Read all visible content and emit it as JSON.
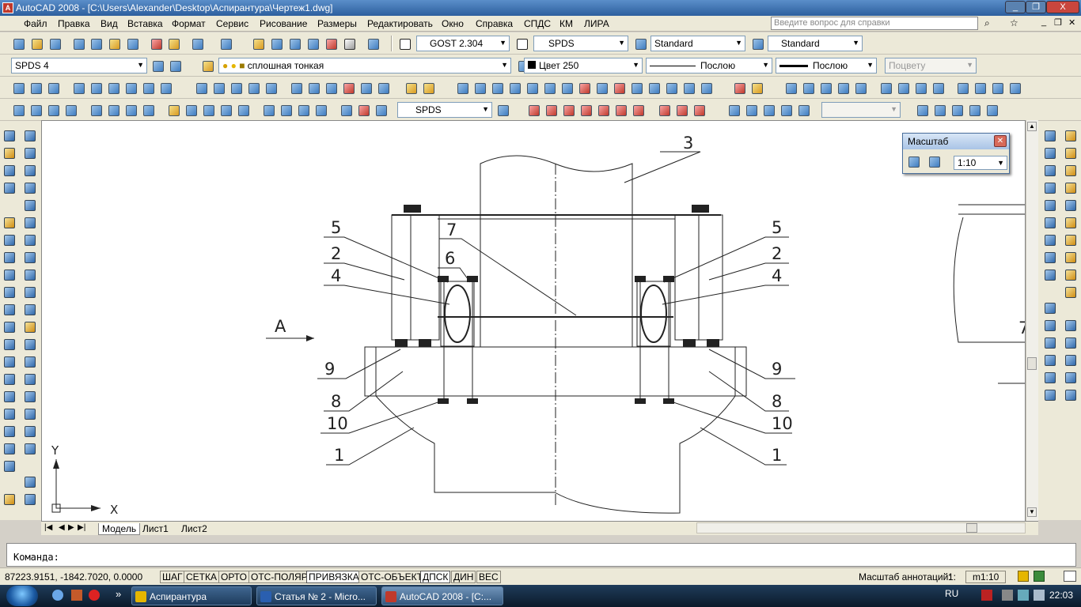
{
  "window": {
    "title": "AutoCAD 2008 - [C:\\Users\\Alexander\\Desktop\\Аспирантура\\Чертеж1.dwg]",
    "minimize": "_",
    "restore": "❐",
    "close": "X"
  },
  "menu": {
    "items": [
      "Файл",
      "Правка",
      "Вид",
      "Вставка",
      "Формат",
      "Сервис",
      "Рисование",
      "Размеры",
      "Редактировать",
      "Окно",
      "Справка",
      "СПДС",
      "КМ",
      "ЛИРА"
    ],
    "help_placeholder": "Введите вопрос для справки"
  },
  "toolbar": {
    "text_style": "GOST 2.304",
    "dim_style": "SPDS",
    "table_style": "Standard",
    "multileader_style": "Standard",
    "workspace": "SPDS 4",
    "layer": "сплошная тонкая",
    "color": "Цвет 250",
    "linetype": "Послою",
    "lineweight": "Послою",
    "plotstyle": "Поцвету",
    "spds_style": "SPDS"
  },
  "scale_panel": {
    "title": "Масштаб",
    "value": "1:10"
  },
  "drawing": {
    "callouts": [
      "1",
      "1",
      "2",
      "2",
      "3",
      "4",
      "4",
      "5",
      "5",
      "6",
      "7",
      "8",
      "8",
      "9",
      "9",
      "10",
      "10"
    ],
    "view_label": "А",
    "axis_x": "X",
    "axis_y": "Y",
    "partial_label": "7"
  },
  "layout_tabs": [
    "Модель",
    "Лист1",
    "Лист2"
  ],
  "command": {
    "prompt": "Команда:"
  },
  "status": {
    "coords": "87223.9151, -1842.7020, 0.0000",
    "toggles": [
      "ШАГ",
      "СЕТКА",
      "ОРТО",
      "ОТС-ПОЛЯР",
      "ПРИВЯЗКА",
      "ОТС-ОБЪЕКТ",
      "ДПСК",
      "ДИН",
      "ВЕС"
    ],
    "toggles_on": [
      "ПРИВЯЗКА",
      "ДПСК"
    ],
    "annot_scale_label": "Масштаб аннотаций:",
    "annot_scale_value": "1:",
    "model_scale": "m1:10"
  },
  "taskbar": {
    "tasks": [
      "Аспирантура",
      "Статья № 2 - Micro...",
      "AutoCAD 2008 - [C:..."
    ],
    "lang": "RU",
    "time": "22:03",
    "more": "»"
  },
  "colors": {
    "titlebar": "#2d5f9e",
    "canvas": "#ffffff",
    "drawing_line": "#222222"
  }
}
